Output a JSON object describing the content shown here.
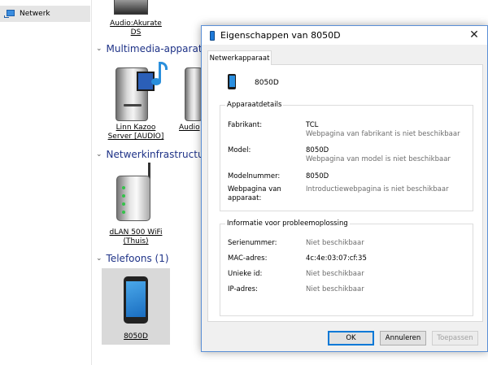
{
  "nav": {
    "network_label": "Netwerk"
  },
  "explorer": {
    "audio_top": {
      "label_line1": "Audio:Akurate",
      "label_line2": "DS"
    },
    "groups": {
      "multimedia": "Multimedia-apparater",
      "network_infra": "Netwerkinfrastructuur",
      "phones": "Telefoons (1)"
    },
    "devices": {
      "linn": {
        "line1": "Linn Kazoo",
        "line2": "Server [AUDIO]"
      },
      "audio_partial": {
        "line1": "Audio"
      },
      "dlan": {
        "line1": "dLAN 500 WiFi",
        "line2": "(Thuis)"
      },
      "phone": {
        "line1": "8050D"
      }
    }
  },
  "dialog": {
    "title": "Eigenschappen van 8050D",
    "close_glyph": "✕",
    "tab": "Netwerkapparaat",
    "device_name": "8050D",
    "details": {
      "title": "Apparaatdetails",
      "manufacturer_label": "Fabrikant:",
      "manufacturer_value": "TCL",
      "manufacturer_sub": "Webpagina van fabrikant is niet beschikbaar",
      "model_label": "Model:",
      "model_value": "8050D",
      "model_sub": "Webpagina van model is niet beschikbaar",
      "modelnumber_label": "Modelnummer:",
      "modelnumber_value": "8050D",
      "webpage_label_line1": "Webpagina van",
      "webpage_label_line2": "apparaat:",
      "webpage_value": "Introductiewebpagina is niet beschikbaar"
    },
    "troubleshooting": {
      "title": "Informatie voor probleemoplossing",
      "serial_label": "Serienummer:",
      "serial_value": "Niet beschikbaar",
      "mac_label": "MAC-adres:",
      "mac_value": "4c:4e:03:07:cf:35",
      "uid_label": "Unieke id:",
      "uid_value": "Niet beschikbaar",
      "ip_label": "IP-adres:",
      "ip_value": "Niet beschikbaar"
    },
    "buttons": {
      "ok": "OK",
      "cancel": "Annuleren",
      "apply": "Toepassen"
    }
  }
}
